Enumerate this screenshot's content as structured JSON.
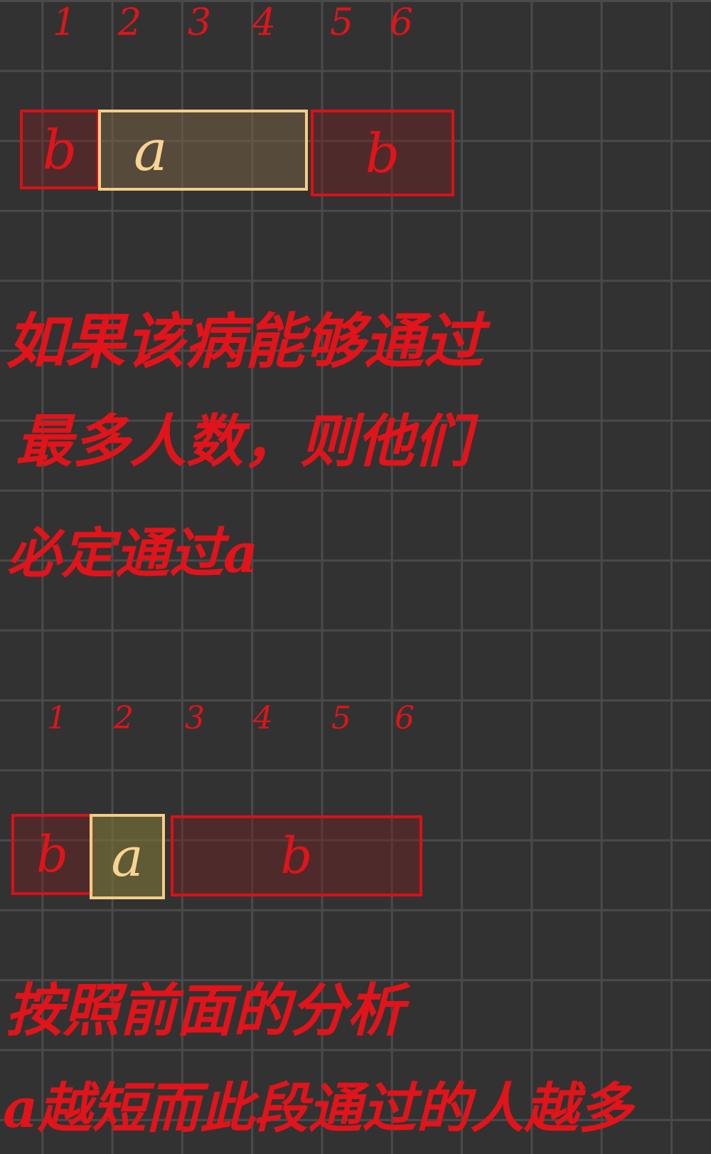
{
  "top_diagram": {
    "column_numbers": [
      "1",
      "2",
      "3",
      "4",
      "5",
      "6"
    ],
    "segments": [
      "b",
      "a",
      "b"
    ]
  },
  "note_1": [
    "如果该病能够通过",
    "最多人数，则他们",
    "必定通过a"
  ],
  "bottom_diagram": {
    "column_numbers": [
      "1",
      "2",
      "3",
      "4",
      "5",
      "6"
    ],
    "segments": [
      "b",
      "a",
      "b"
    ]
  },
  "note_2": [
    "按照前面的分析",
    "a越短而此段通过的人越多"
  ],
  "colors": {
    "background": "#323232",
    "grid": "#4a4a4a",
    "ink_red": "#e0141a",
    "ink_yellow": "#f4cd86"
  }
}
